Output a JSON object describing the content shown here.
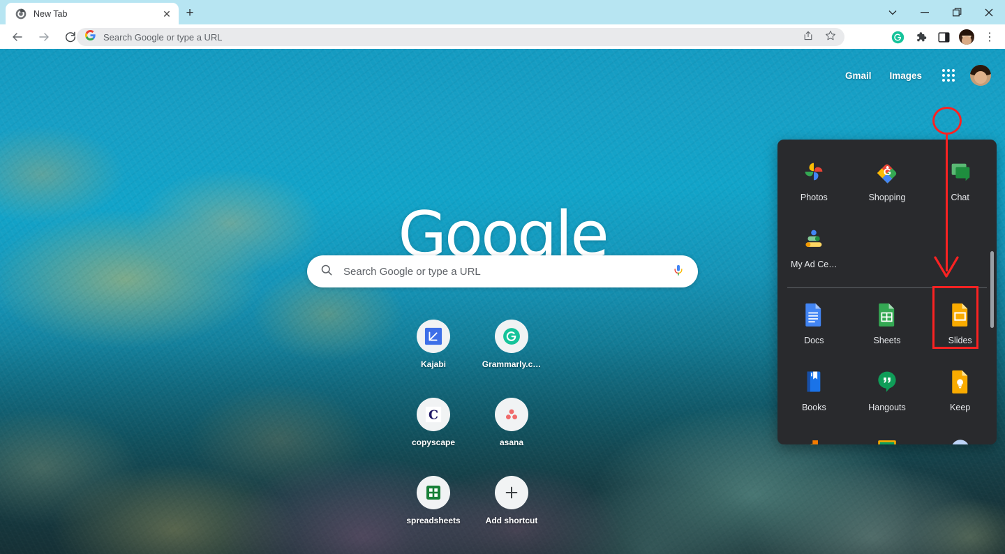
{
  "window": {
    "controls": [
      {
        "name": "tab-search",
        "glyph": "⌄"
      },
      {
        "name": "minimize",
        "glyph": "—"
      },
      {
        "name": "maximize",
        "glyph": "❐"
      },
      {
        "name": "close",
        "glyph": "✕"
      }
    ]
  },
  "tabstrip": {
    "tab_title": "New Tab",
    "close_glyph": "✕",
    "newtab_glyph": "+",
    "background_color": "#b7e5f2"
  },
  "toolbar": {
    "back_glyph": "←",
    "forward_glyph": "→",
    "reload_glyph": "↻",
    "omnibox_placeholder": "Search Google or type a URL",
    "omnibox_value": "",
    "share_label": "Share this page",
    "bookmark_label": "Bookmark this tab",
    "grammarly_label": "Grammarly",
    "extensions_label": "Extensions",
    "sidepanel_label": "Side panel",
    "profile_label": "Profile",
    "menu_glyph": "⋮"
  },
  "newtab": {
    "logo_text": "Google",
    "header_links": [
      {
        "label": "Gmail"
      },
      {
        "label": "Images"
      }
    ],
    "apps_button_label": "Google apps",
    "avatar_label": "Google Account",
    "searchbox": {
      "placeholder": "Search Google or type a URL",
      "value": "",
      "search_icon": "search-icon",
      "voice_icon": "microphone-icon"
    },
    "shortcuts": [
      {
        "label": "Kajabi",
        "icon": "kajabi-icon"
      },
      {
        "label": "Grammarly.c…",
        "icon": "grammarly-icon"
      },
      {
        "label": "copyscape",
        "icon": "copyscape-icon"
      },
      {
        "label": "asana",
        "icon": "asana-icon"
      },
      {
        "label": "spreadsheets",
        "icon": "sheets-icon"
      },
      {
        "label": "Add shortcut",
        "icon": "plus-icon"
      }
    ]
  },
  "apps_panel": {
    "background_color": "#292a2d",
    "top_apps": [
      {
        "label": "Photos",
        "icon": "google-photos-icon"
      },
      {
        "label": "Shopping",
        "icon": "google-shopping-icon"
      },
      {
        "label": "Chat",
        "icon": "google-chat-icon"
      },
      {
        "label": "My Ad Ce…",
        "icon": "my-ad-center-icon"
      }
    ],
    "bottom_apps": [
      {
        "label": "Docs",
        "icon": "google-docs-icon"
      },
      {
        "label": "Sheets",
        "icon": "google-sheets-icon"
      },
      {
        "label": "Slides",
        "icon": "google-slides-icon"
      },
      {
        "label": "Books",
        "icon": "google-books-icon"
      },
      {
        "label": "Hangouts",
        "icon": "google-hangouts-icon"
      },
      {
        "label": "Keep",
        "icon": "google-keep-icon"
      },
      {
        "label": "",
        "icon": "google-jamboard-icon"
      },
      {
        "label": "",
        "icon": "google-classroom-icon"
      },
      {
        "label": "",
        "icon": "google-earth-icon"
      }
    ]
  },
  "annotation": {
    "color": "#fb2222",
    "circle_target": "apps-grid-button",
    "arrow_target": "Slides",
    "box_target": "Slides"
  }
}
